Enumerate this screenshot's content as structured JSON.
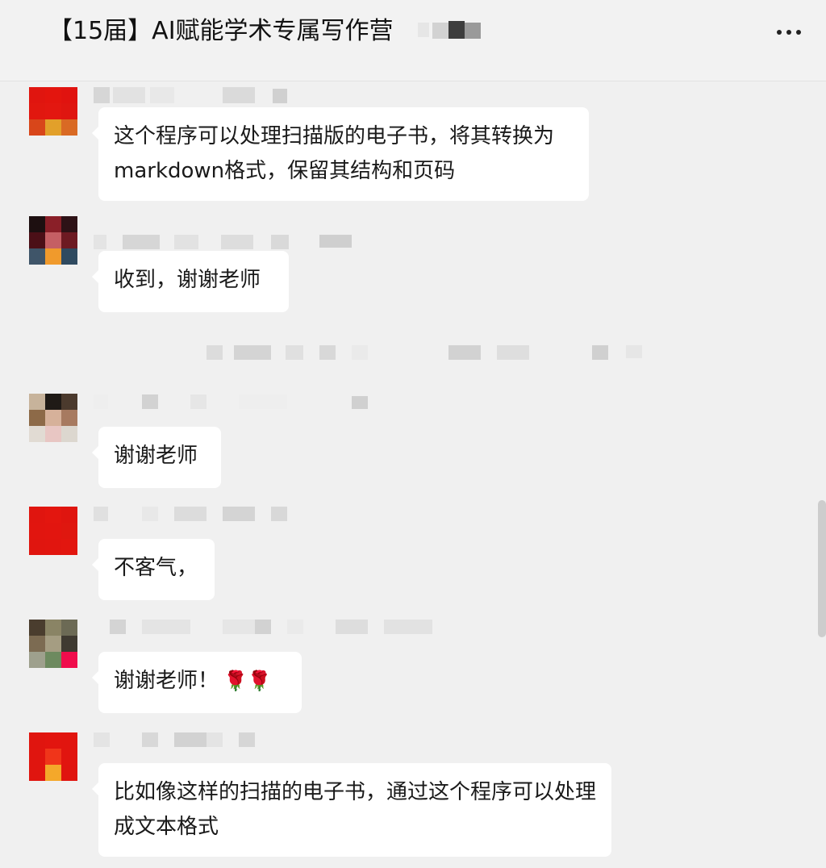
{
  "header": {
    "title": "【15届】AI赋能学术专属写作营",
    "more_icon": "ellipsis-icon"
  },
  "messages": [
    {
      "text": "这个程序可以处理扫描版的电子书，将其转换为markdown格式，保留其结构和页码"
    },
    {
      "text": "收到，谢谢老师"
    },
    {
      "text": "谢谢老师"
    },
    {
      "text": "不客气，"
    },
    {
      "text": "谢谢老师！",
      "emoji": "🌹🌹"
    },
    {
      "text": "比如像这样的扫描的电子书，通过这个程序可以处理成文本格式"
    }
  ],
  "colors": {
    "background": "#f0f0f0",
    "bubble": "#ffffff",
    "avatar_red": "#e0150f"
  }
}
